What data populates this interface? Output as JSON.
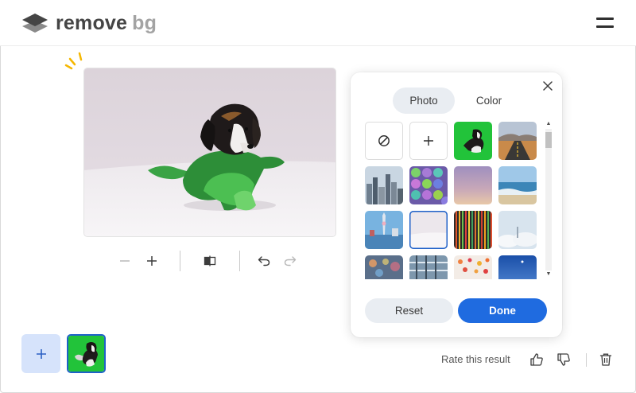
{
  "header": {
    "logo_word1": "remove",
    "logo_word2": "bg",
    "menu_icon": "hamburger-menu-icon"
  },
  "editor": {
    "image_alt": "Beagle puppy on green-tinted background",
    "toolbar": {
      "zoom_out_icon": "minus-icon",
      "zoom_in_icon": "plus-icon",
      "compare_icon": "compare-split-icon",
      "undo_icon": "undo-icon",
      "redo_icon": "redo-icon"
    }
  },
  "background_picker": {
    "tabs": [
      {
        "label": "Photo",
        "active": true
      },
      {
        "label": "Color",
        "active": false
      }
    ],
    "close_icon": "close-icon",
    "tiles": [
      {
        "kind": "none",
        "icon": "no-background-icon"
      },
      {
        "kind": "add",
        "icon": "plus-icon"
      },
      {
        "kind": "image",
        "subject": "puppy on green"
      },
      {
        "kind": "image",
        "subject": "desert road"
      },
      {
        "kind": "image",
        "subject": "city skyline"
      },
      {
        "kind": "image",
        "subject": "colorful balls"
      },
      {
        "kind": "image",
        "subject": "purple gradient sky"
      },
      {
        "kind": "image",
        "subject": "beach waves"
      },
      {
        "kind": "image",
        "subject": "harbor tower"
      },
      {
        "kind": "image",
        "subject": "white studio",
        "selected": true
      },
      {
        "kind": "image",
        "subject": "colorful stripes"
      },
      {
        "kind": "image",
        "subject": "sky over clouds"
      },
      {
        "kind": "image",
        "subject": "bokeh lights"
      },
      {
        "kind": "image",
        "subject": "glass building"
      },
      {
        "kind": "image",
        "subject": "flower petals"
      },
      {
        "kind": "image",
        "subject": "blue sky"
      }
    ],
    "reset_label": "Reset",
    "done_label": "Done"
  },
  "bottom": {
    "add_image_icon": "plus-icon",
    "rate_label": "Rate this result",
    "thumbs_up_icon": "thumbs-up-icon",
    "thumbs_down_icon": "thumbs-down-icon",
    "delete_icon": "trash-icon"
  },
  "colors": {
    "accent": "#1f6be0",
    "selected_border": "#1f61c9",
    "upload_bg": "#d6e3fb",
    "pill_bg": "#e9edf2",
    "logo_dark": "#454545",
    "logo_light": "#a3a3a3"
  }
}
